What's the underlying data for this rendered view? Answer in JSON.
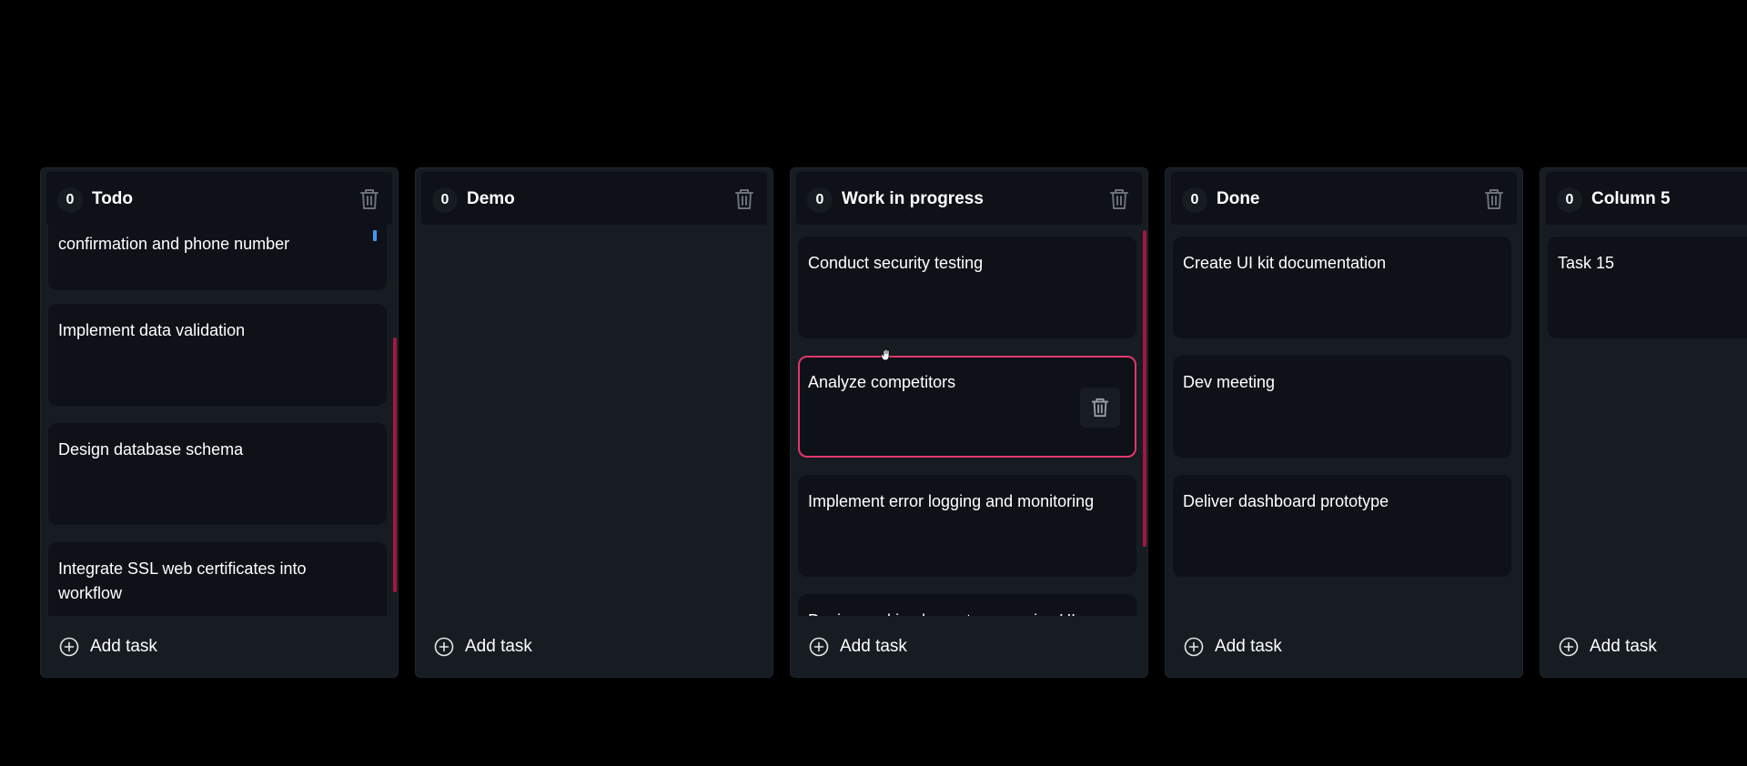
{
  "board": {
    "columns": [
      {
        "count": "0",
        "title": "Todo",
        "cards": [
          "confirmation and phone number",
          "Implement data validation",
          "Design database schema",
          "Integrate SSL web certificates into workflow"
        ],
        "add_label": "Add task"
      },
      {
        "count": "0",
        "title": "Demo",
        "cards": [],
        "add_label": "Add task"
      },
      {
        "count": "0",
        "title": "Work in progress",
        "cards": [
          "Conduct security testing",
          "Analyze competitors",
          "Implement error logging and monitoring",
          "Design and implement responsive UI"
        ],
        "add_label": "Add task"
      },
      {
        "count": "0",
        "title": "Done",
        "cards": [
          "Create UI kit documentation",
          "Dev meeting",
          "Deliver dashboard prototype"
        ],
        "add_label": "Add task"
      },
      {
        "count": "0",
        "title": "Column 5",
        "cards": [
          "Task 15"
        ],
        "add_label": "Add task"
      }
    ]
  },
  "icons": {
    "column_delete": "trash-icon",
    "card_delete": "trash-icon",
    "add": "plus-circle-icon",
    "cursor": "grab-hand-icon"
  },
  "colors": {
    "background": "#000000",
    "column_bg": "#161c22",
    "card_bg": "#0e1117",
    "active_border": "#e0386a",
    "scrollbar": "#a3173f",
    "drag_indicator": "#3b9af5"
  }
}
